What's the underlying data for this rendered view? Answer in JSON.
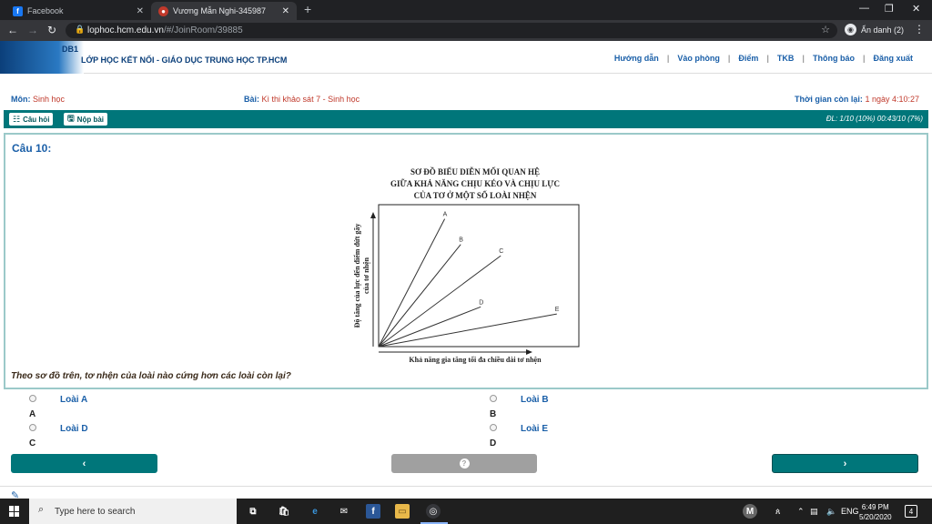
{
  "browser": {
    "tabs": [
      {
        "title": "Facebook",
        "icon": "facebook-icon"
      },
      {
        "title": "Vương Mẫn Nghi-345987",
        "icon": "site-icon"
      }
    ],
    "url_host": "lophoc.hcm.edu.vn",
    "url_path": "/#/JoinRoom/39885",
    "profile_label": "Ẩn danh (2)"
  },
  "site": {
    "logo_text": "DB1",
    "title": "LỚP HỌC KẾT NỐI -  GIÁO DỤC TRUNG HỌC TP.HCM",
    "nav": [
      "Hướng dẫn",
      "Vào phòng",
      "Điểm",
      "TKB",
      "Thông báo",
      "Đăng xuất"
    ]
  },
  "exam": {
    "subject_label": "Môn:",
    "subject": "Sinh học",
    "lesson_label": "Bài:",
    "lesson": "Kì thi khảo sát 7 - Sinh học",
    "time_label": "Thời gian còn lại:",
    "time_left": "1 ngày 4:10:27",
    "questions_btn": "Câu hỏi",
    "submit_btn": "Nộp bài",
    "progress": "ĐL: 1/10 (10%)  00:43/10 (7%)"
  },
  "question": {
    "title": "Câu 10:",
    "text": "Theo sơ đồ trên, tơ nhện của loài nào cứng hơn các loài còn lại?",
    "answers": [
      {
        "label": "Loài A",
        "letter": "A"
      },
      {
        "label": "Loài B",
        "letter": "B"
      },
      {
        "label": "Loài D",
        "letter": "C"
      },
      {
        "label": "Loài E",
        "letter": "D"
      }
    ]
  },
  "chart_data": {
    "type": "line",
    "title": [
      "SƠ ĐỒ BIỂU DIỄN MỐI QUAN HỆ",
      "GIỮA KHẢ NĂNG CHỊU KÉO VÀ CHỊU LỰC",
      "CỦA TƠ Ở MỘT SỐ LOÀI NHỆN"
    ],
    "xlabel": "Khả năng gia tăng tối đa chiều dài tơ nhện",
    "ylabel": [
      "Độ tăng của lực đến điểm đứt gãy",
      "của tơ nhện"
    ],
    "xlim": [
      0,
      100
    ],
    "ylim": [
      0,
      100
    ],
    "grid": false,
    "series": [
      {
        "name": "A",
        "x": [
          0,
          33
        ],
        "y": [
          0,
          90
        ]
      },
      {
        "name": "B",
        "x": [
          0,
          41
        ],
        "y": [
          0,
          72
        ]
      },
      {
        "name": "C",
        "x": [
          0,
          61
        ],
        "y": [
          0,
          64
        ]
      },
      {
        "name": "D",
        "x": [
          0,
          51
        ],
        "y": [
          0,
          28
        ]
      },
      {
        "name": "E",
        "x": [
          0,
          89
        ],
        "y": [
          0,
          23
        ]
      }
    ]
  },
  "taskbar": {
    "search_placeholder": "Type here to search",
    "lang": "ENG",
    "time": "6:49 PM",
    "date": "5/20/2020",
    "notifications": "4"
  }
}
